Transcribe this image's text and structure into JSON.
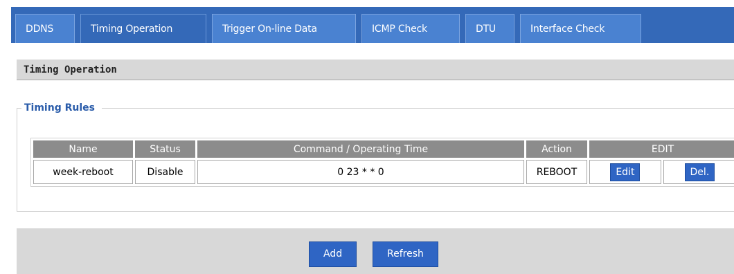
{
  "tabs": [
    {
      "label": "DDNS"
    },
    {
      "label": "Timing Operation"
    },
    {
      "label": "Trigger On-line Data"
    },
    {
      "label": "ICMP Check"
    },
    {
      "label": "DTU"
    },
    {
      "label": "Interface Check"
    }
  ],
  "active_tab": "Timing Operation",
  "section": {
    "title": "Timing Operation"
  },
  "rules": {
    "legend": "Timing Rules",
    "columns": {
      "name": "Name",
      "status": "Status",
      "command": "Command / Operating Time",
      "action": "Action",
      "edit": "EDIT"
    },
    "rows": [
      {
        "name": "week-reboot",
        "status": "Disable",
        "command": "0 23 * * 0",
        "action": "REBOOT",
        "edit_label": "Edit",
        "del_label": "Del."
      }
    ]
  },
  "footer": {
    "add_label": "Add",
    "refresh_label": "Refresh"
  },
  "colors": {
    "tab_bar": "#3469b8",
    "tab": "#4a82d1",
    "button": "#2f65c4",
    "header_cell": "#8c8c8c"
  }
}
